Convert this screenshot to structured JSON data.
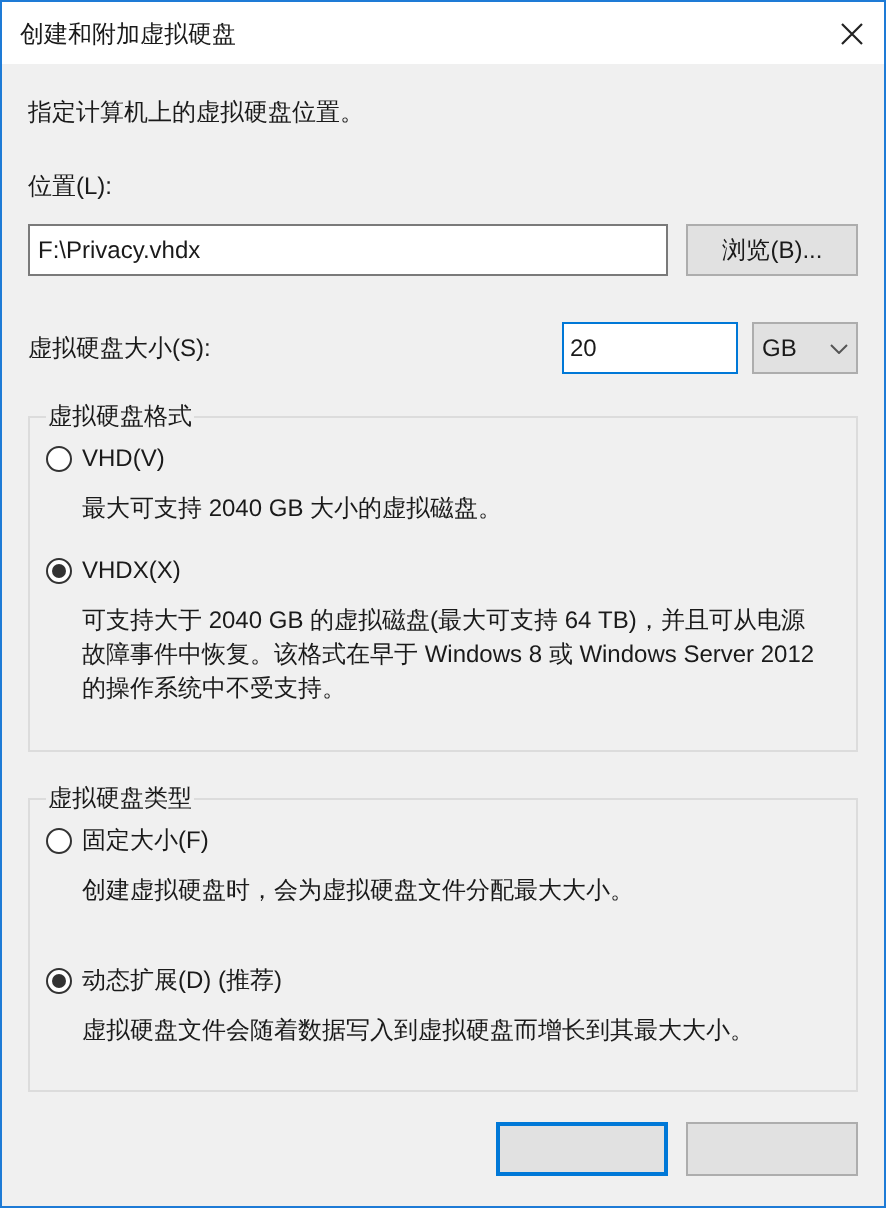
{
  "window": {
    "title": "创建和附加虚拟硬盘"
  },
  "instructions": "指定计算机上的虚拟硬盘位置。",
  "location": {
    "label": "位置(L):",
    "value": "F:\\Privacy.vhdx",
    "browse_button": "浏览(B)..."
  },
  "size": {
    "label": "虚拟硬盘大小(S):",
    "value": "20",
    "unit": "GB"
  },
  "format_group": {
    "title": "虚拟硬盘格式",
    "options": [
      {
        "label": "VHD(V)",
        "selected": false,
        "description": "最大可支持 2040 GB 大小的虚拟磁盘。"
      },
      {
        "label": "VHDX(X)",
        "selected": true,
        "description": "可支持大于 2040 GB 的虚拟磁盘(最大可支持 64 TB)，并且可从电源故障事件中恢复。该格式在早于 Windows 8 或 Windows Server 2012 的操作系统中不受支持。"
      }
    ]
  },
  "type_group": {
    "title": "虚拟硬盘类型",
    "options": [
      {
        "label": "固定大小(F)",
        "selected": false,
        "description": "创建虚拟硬盘时，会为虚拟硬盘文件分配最大大小。"
      },
      {
        "label": "动态扩展(D) (推荐)",
        "selected": true,
        "description": "虚拟硬盘文件会随着数据写入到虚拟硬盘而增长到其最大大小。"
      }
    ]
  },
  "buttons": [
    {
      "kind": "default"
    },
    {
      "kind": "normal"
    }
  ]
}
